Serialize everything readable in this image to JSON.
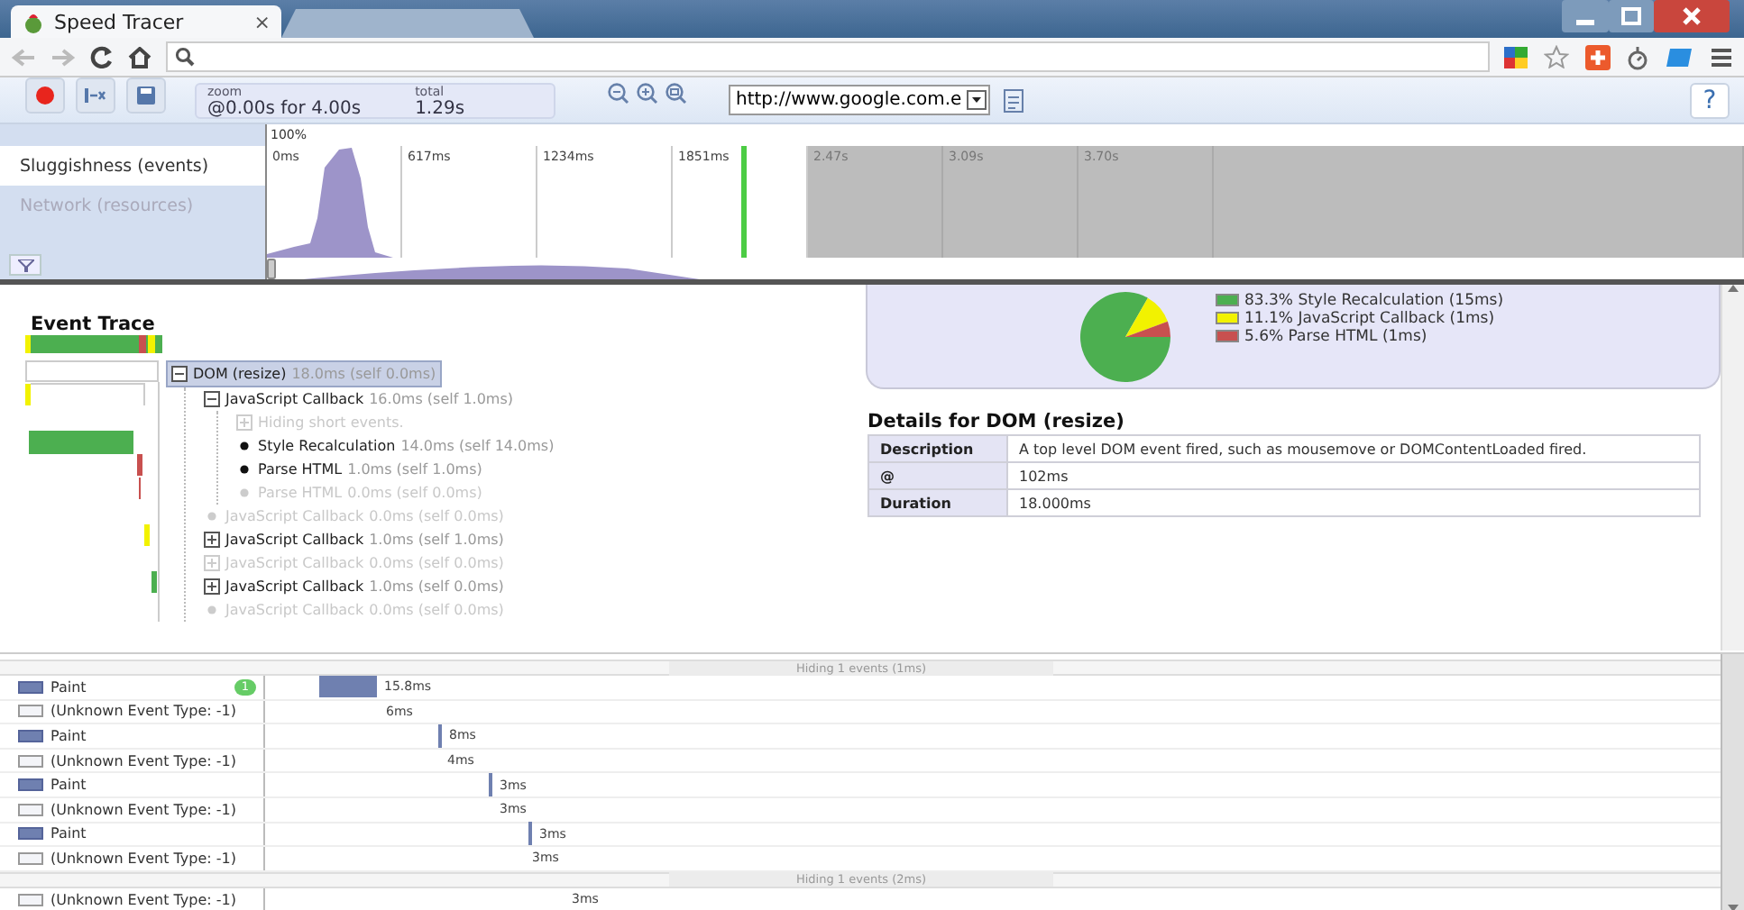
{
  "browser": {
    "tab_title": "Speed Tracer",
    "tab_close": "×"
  },
  "toolbar": {
    "zoom_label": "zoom",
    "zoom_value": "@0.00s for 4.00s",
    "total_label": "total",
    "total_value": "1.29s",
    "url": "http://www.google.com.e",
    "help": "?"
  },
  "overview": {
    "tabs": [
      {
        "label": "Sluggishness (events)",
        "selected": true
      },
      {
        "label": "Network (resources)",
        "selected": false
      }
    ],
    "scale": "100%",
    "ticks": [
      "0ms",
      "617ms",
      "1234ms",
      "1851ms",
      "2.47s",
      "3.09s",
      "3.70s"
    ]
  },
  "trace": {
    "title": "Event Trace",
    "tree": [
      {
        "label": "DOM (resize)",
        "timing": "18.0ms (self 0.0ms)",
        "kind": "group",
        "expanded": true,
        "dimmed": false,
        "selected": true,
        "children": [
          {
            "label": "JavaScript Callback",
            "timing": "16.0ms (self 1.0ms)",
            "kind": "group",
            "expanded": true,
            "dimmed": false,
            "selected": false,
            "children": [
              {
                "label": "Hiding short events.",
                "kind": "group",
                "expanded": false,
                "dimmed": true,
                "selected": false
              },
              {
                "label": "Style Recalculation",
                "timing": "14.0ms (self 14.0ms)",
                "kind": "leaf",
                "dimmed": false,
                "selected": false
              },
              {
                "label": "Parse HTML",
                "timing": "1.0ms (self 1.0ms)",
                "kind": "leaf",
                "dimmed": false,
                "selected": false
              },
              {
                "label": "Parse HTML",
                "timing": "0.0ms (self 0.0ms)",
                "kind": "leaf",
                "dimmed": true,
                "selected": false
              }
            ]
          },
          {
            "label": "JavaScript Callback",
            "timing": "0.0ms (self 0.0ms)",
            "kind": "leaf",
            "dimmed": true,
            "selected": false
          },
          {
            "label": "JavaScript Callback",
            "timing": "1.0ms (self 1.0ms)",
            "kind": "group",
            "expanded": false,
            "dimmed": false,
            "selected": false
          },
          {
            "label": "JavaScript Callback",
            "timing": "0.0ms (self 0.0ms)",
            "kind": "group",
            "expanded": false,
            "dimmed": true,
            "selected": false
          },
          {
            "label": "JavaScript Callback",
            "timing": "1.0ms (self 0.0ms)",
            "kind": "group",
            "expanded": false,
            "dimmed": false,
            "selected": false
          },
          {
            "label": "JavaScript Callback",
            "timing": "0.0ms (self 0.0ms)",
            "kind": "leaf",
            "dimmed": true,
            "selected": false
          }
        ]
      }
    ]
  },
  "breakdown": {
    "chart_data": {
      "type": "pie",
      "categories": [
        "83.3% Style Recalculation (15ms)",
        "11.1% JavaScript Callback (1ms)",
        "5.6% Parse HTML (1ms)"
      ],
      "values": [
        83.3,
        11.1,
        5.6
      ],
      "legend": "right"
    },
    "slices": [
      {
        "color": "#4caf50"
      },
      {
        "color": "#f2f200"
      },
      {
        "color": "#c8504f"
      }
    ]
  },
  "details": {
    "title": "Details for DOM (resize)",
    "rows": [
      {
        "label": "Description",
        "value": "A top level DOM event fired, such as mousemove or DOMContentLoaded fired."
      },
      {
        "label": "@",
        "value": "102ms"
      },
      {
        "label": "Duration",
        "value": "18.000ms"
      }
    ]
  },
  "timeline": {
    "rows": [
      {
        "kind": "hidden",
        "label": "Hiding 1 events (1ms)"
      },
      {
        "kind": "paint",
        "label": "Paint",
        "badge": "1",
        "duration": "15.8ms"
      },
      {
        "kind": "unknown",
        "label": "(Unknown Event Type: -1)",
        "duration": "6ms"
      },
      {
        "kind": "paint",
        "label": "Paint",
        "duration": "8ms"
      },
      {
        "kind": "unknown",
        "label": "(Unknown Event Type: -1)",
        "duration": "4ms"
      },
      {
        "kind": "paint",
        "label": "Paint",
        "duration": "3ms"
      },
      {
        "kind": "unknown",
        "label": "(Unknown Event Type: -1)",
        "duration": "3ms"
      },
      {
        "kind": "paint",
        "label": "Paint",
        "duration": "3ms"
      },
      {
        "kind": "unknown",
        "label": "(Unknown Event Type: -1)",
        "duration": "3ms"
      },
      {
        "kind": "hidden",
        "label": "Hiding 1 events (2ms)"
      },
      {
        "kind": "unknown",
        "label": "(Unknown Event Type: -1)",
        "duration": "3ms"
      }
    ]
  }
}
